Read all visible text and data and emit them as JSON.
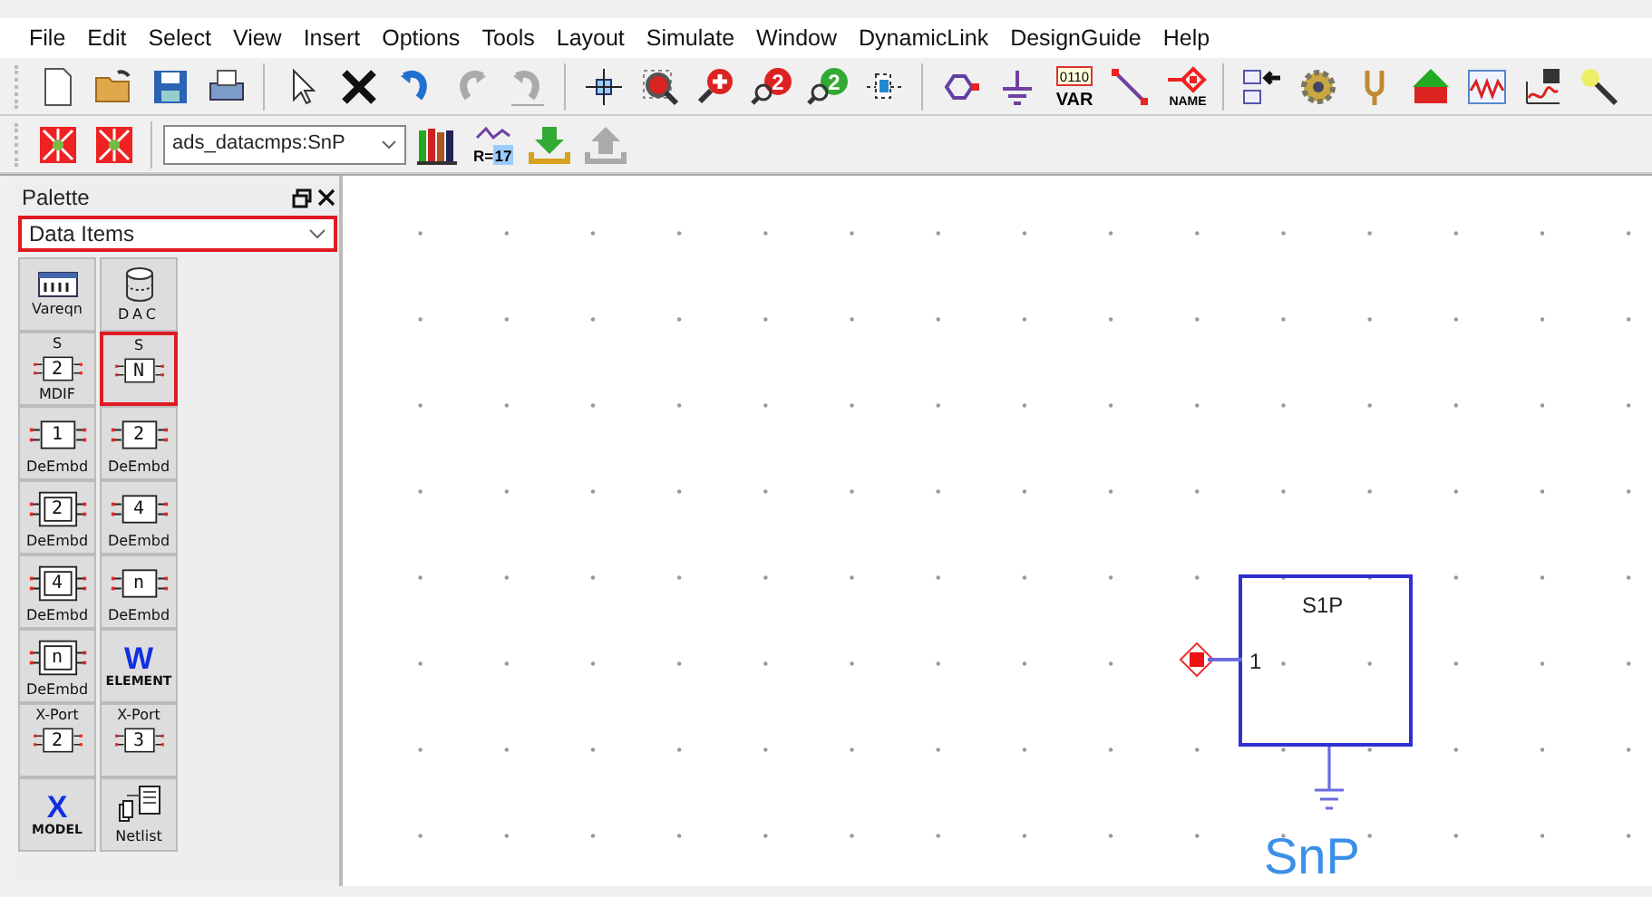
{
  "menu": [
    "File",
    "Edit",
    "Select",
    "View",
    "Insert",
    "Options",
    "Tools",
    "Layout",
    "Simulate",
    "Window",
    "DynamicLink",
    "DesignGuide",
    "Help"
  ],
  "toolbar": [
    {
      "kind": "new",
      "disabled": false
    },
    {
      "kind": "open",
      "disabled": false
    },
    {
      "kind": "save",
      "disabled": false
    },
    {
      "kind": "print",
      "disabled": false
    },
    {
      "kind": "sep"
    },
    {
      "kind": "pointer",
      "disabled": false
    },
    {
      "kind": "delete",
      "disabled": false
    },
    {
      "kind": "undo",
      "disabled": false
    },
    {
      "kind": "redo",
      "disabled": true
    },
    {
      "kind": "undo2",
      "disabled": true
    },
    {
      "kind": "sep"
    },
    {
      "kind": "pan",
      "disabled": false
    },
    {
      "kind": "zoomarea",
      "disabled": false
    },
    {
      "kind": "zoomin",
      "disabled": false
    },
    {
      "kind": "zoomnum",
      "texts": [
        "2"
      ],
      "disabled": false
    },
    {
      "kind": "zoomout",
      "texts": [
        "2"
      ],
      "disabled": false
    },
    {
      "kind": "pinbox",
      "disabled": false
    },
    {
      "kind": "sep"
    },
    {
      "kind": "port",
      "disabled": false
    },
    {
      "kind": "ground",
      "disabled": false
    },
    {
      "kind": "var",
      "texts": [
        "0110",
        "VAR"
      ],
      "disabled": false
    },
    {
      "kind": "wire",
      "disabled": false
    },
    {
      "kind": "name",
      "texts": [
        "NAME"
      ],
      "disabled": false
    },
    {
      "kind": "sep"
    },
    {
      "kind": "swap",
      "disabled": false
    },
    {
      "kind": "gear",
      "disabled": false
    },
    {
      "kind": "fork",
      "disabled": false
    },
    {
      "kind": "uparrow",
      "disabled": false
    },
    {
      "kind": "graph",
      "disabled": false
    },
    {
      "kind": "savegraph",
      "disabled": false
    },
    {
      "kind": "wand",
      "disabled": false
    }
  ],
  "toolbar2": {
    "leading": [
      {
        "kind": "xbox",
        "disabled": false
      },
      {
        "kind": "xbox",
        "disabled": false
      }
    ],
    "library_combo": {
      "value": "ads_datacmps:SnP"
    },
    "trailing": [
      {
        "kind": "books",
        "disabled": false
      },
      {
        "kind": "spec",
        "texts": [
          "R=",
          "17"
        ],
        "disabled": false
      },
      {
        "kind": "download",
        "disabled": false
      },
      {
        "kind": "upload",
        "disabled": true
      }
    ]
  },
  "palette": {
    "title": "Palette",
    "category": {
      "value": "Data Items",
      "highlighted": true
    },
    "items": [
      {
        "kind": "vareqn",
        "label": "Vareqn",
        "selected": false
      },
      {
        "kind": "dac",
        "label": "DAC",
        "selected": false
      },
      {
        "kind": "box",
        "top": "S",
        "glyph": "2",
        "label": "MDIF",
        "selected": false
      },
      {
        "kind": "box",
        "top": "S",
        "glyph": "N",
        "selected": true
      },
      {
        "kind": "box",
        "glyph": "1",
        "label": "DeEmbd",
        "selected": false
      },
      {
        "kind": "box",
        "glyph": "2",
        "label": "DeEmbd",
        "selected": false
      },
      {
        "kind": "double",
        "glyph": "2",
        "label": "DeEmbd",
        "selected": false
      },
      {
        "kind": "box",
        "glyph": "4",
        "label": "DeEmbd",
        "selected": false
      },
      {
        "kind": "double",
        "glyph": "4",
        "label": "DeEmbd",
        "selected": false
      },
      {
        "kind": "box",
        "glyph": "n",
        "label": "DeEmbd",
        "selected": false
      },
      {
        "kind": "double",
        "glyph": "n",
        "label": "DeEmbd",
        "selected": false
      },
      {
        "kind": "letter",
        "glyph": "W",
        "label": "ELEMENT",
        "selected": false
      },
      {
        "kind": "box",
        "top": "X-Port",
        "glyph": "2",
        "selected": false
      },
      {
        "kind": "box",
        "top": "X-Port",
        "glyph": "3",
        "selected": false
      },
      {
        "kind": "letter",
        "glyph": "X",
        "label": "MODEL",
        "selected": false
      },
      {
        "kind": "netlist",
        "label": "Netlist",
        "selected": false
      }
    ]
  },
  "canvas": {
    "component": {
      "name": "S1P",
      "port": "1",
      "label": "SnP"
    }
  }
}
